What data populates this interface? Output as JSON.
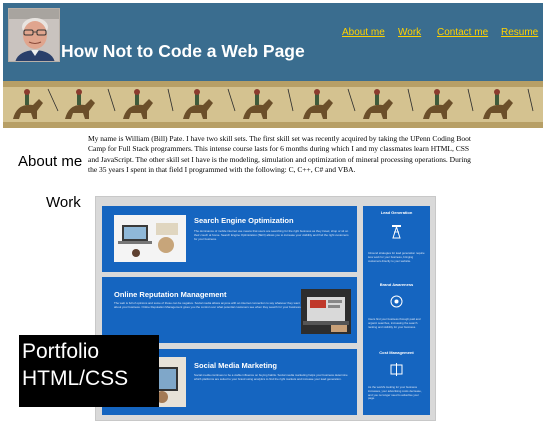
{
  "header": {
    "title": "How Not to Code a Web Page",
    "nav": [
      "About me",
      "Work",
      "Contact me",
      "Resume"
    ],
    "background_color": "#3a6d8f",
    "nav_color": "#ffd200"
  },
  "about": {
    "heading": "About me",
    "text": "My name is William (Bill) Pate. I have two skill sets. The first skill set was recently acquired by taking the UPenn Coding Boot Camp for Full Stack programmers. This intense course lasts for 6 months during which I and my classmates learn HTML, CSS and JavaScript. The other skill set I have is the modeling, simulation and optimization of mineral processing operations. During the 35 years I spent in that field I programmed with the following: C, C++, C# and VBA."
  },
  "work": {
    "heading": "Work",
    "cards": [
      {
        "title": "Search Engine Optimization",
        "text": "The dominance of mobile internet use means that users are searching for the right business as they travel, shop or sit on their couch at home. Search Engine Optimization (SEO) allows you to increase your visibility and find the right customers for your business."
      },
      {
        "title": "Online Reputation Management",
        "text": "The web is full of opinions and some of those can be negative. Social media allows anyone with an internet connection to say whatever they want about your business. Online Reputation Management gives you the control over what potential customers see when they search for your business."
      },
      {
        "title": "Social Media Marketing",
        "text": "Social media continues to be a viable influence on buying habits. Social media marketing helps your business determine which platforms are suited to your brand using analytics to find the right markets and increase your lead generation."
      }
    ],
    "side": [
      {
        "title": "Lead Generation",
        "text": "Inbound strategies for lead generation require less work for your business, bringing customers directly to your website."
      },
      {
        "title": "Brand Awareness",
        "text": "Users find your business through paid and organic searches, increasing the search ranking and visibility for your business."
      },
      {
        "title": "Cost Management",
        "text": "As the world's looking for your business increases, your advertising costs decrease, and you no longer need to advertise your page."
      }
    ]
  },
  "overlay": {
    "line1": "Portfolio",
    "line2": "HTML/CSS"
  }
}
